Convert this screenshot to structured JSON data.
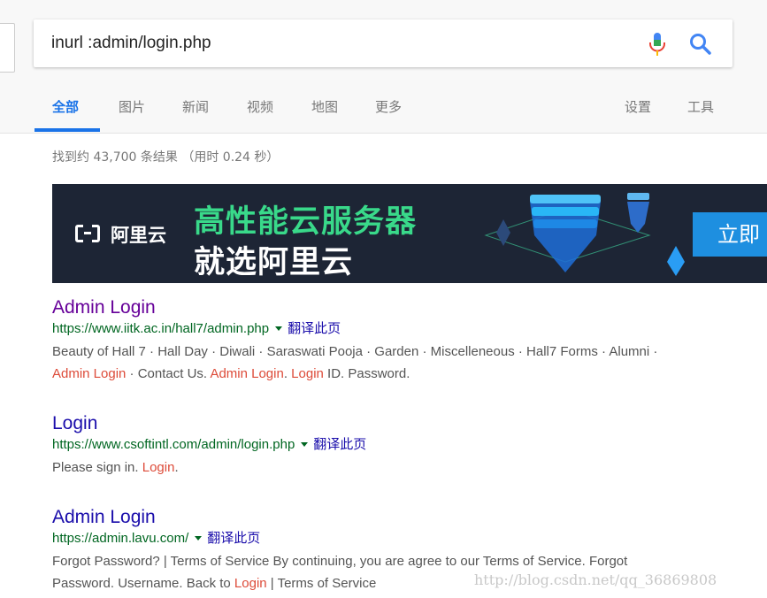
{
  "search": {
    "query": "inurl :admin/login.php"
  },
  "tabs": [
    {
      "label": "全部"
    },
    {
      "label": "图片"
    },
    {
      "label": "新闻"
    },
    {
      "label": "视频"
    },
    {
      "label": "地图"
    },
    {
      "label": "更多"
    },
    {
      "label": "设置"
    },
    {
      "label": "工具"
    }
  ],
  "stats": "找到约 43,700 条结果 （用时 0.24 秒）",
  "ad": {
    "brand": "阿里云",
    "headline": "高性能云服务器",
    "subheadline": "就选阿里云",
    "cta": "立即"
  },
  "results": [
    {
      "title": "Admin Login",
      "url": "https://www.iitk.ac.in/hall7/admin.php",
      "translate": "翻译此页",
      "snippet": {
        "line1": "Beauty of Hall 7 · Hall Day · Diwali · Saraswati Pooja · Garden · Miscelleneous · Hall7 Forms · Alumni ·",
        "hl1": "Admin Login",
        "t1": " · Contact Us. ",
        "hl2": "Admin Login",
        "t2": ". ",
        "hl3": "Login",
        "t3": " ID. Password."
      }
    },
    {
      "title": "Login",
      "url": "https://www.csoftintl.com/admin/login.php",
      "translate": "翻译此页",
      "snippet": {
        "t1": "Please sign in. ",
        "hl1": "Login",
        "t2": "."
      }
    },
    {
      "title": "Admin Login",
      "url": "https://admin.lavu.com/",
      "translate": "翻译此页",
      "snippet": {
        "line1": "Forgot Password? | Terms of Service By continuing, you are agree to our Terms of Service. Forgot",
        "t1": "Password. Username. Back to ",
        "hl1": "Login",
        "t2": " | Terms of Service"
      }
    }
  ],
  "watermark": "http://blog.csdn.net/qq_36869808",
  "colors": {
    "accent": "#1a73e8",
    "link": "#1a0dab",
    "visited": "#660099",
    "url": "#006621",
    "highlight": "#dd4b39"
  }
}
